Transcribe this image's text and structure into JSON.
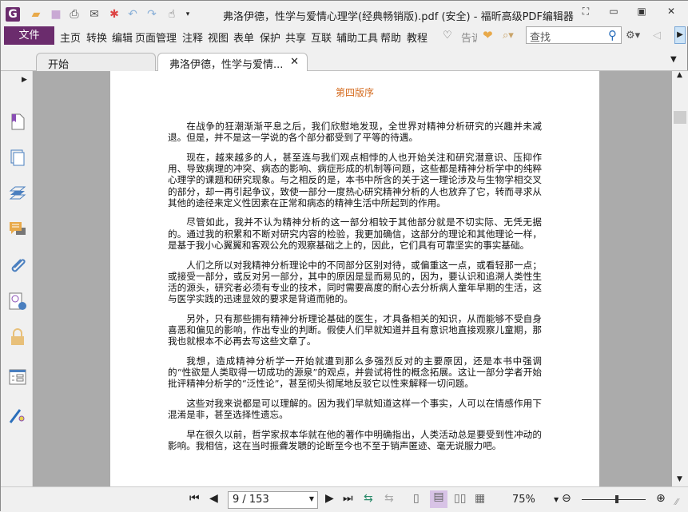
{
  "window": {
    "title": "弗洛伊德，性学与爱情心理学(经典畅销版).pdf (安全) - 福昕高级PDF编辑器"
  },
  "menu": {
    "file": "文件",
    "items": [
      "主页",
      "转换",
      "编辑",
      "页面管理",
      "注释",
      "视图",
      "表单",
      "保护",
      "共享",
      "互联",
      "辅助工具",
      "帮助",
      "教程"
    ],
    "tell": "告诉",
    "search_placeholder": "查找"
  },
  "tabs": [
    {
      "label": "开始"
    },
    {
      "label": "弗洛伊德，性学与爱情...",
      "close": "✕"
    }
  ],
  "page": {
    "title": "第四版序",
    "paragraphs": [
      "在战争的狂潮渐渐平息之后，我们欣慰地发现，全世界对精神分析研究的兴趣并未减退。但是，并不是这一学说的各个部分都受到了平等的待遇。",
      "现在，越来越多的人，甚至连与我们观点相悖的人也开始关注和研究潜意识、压抑作用、导致病理的冲突、病态的影响、病症形成的机制等问题，这些都是精神分析学中的纯粹心理学的课题和研究现象。与之相反的是，本书中所含的关于这一理论涉及与生物学相交叉的部分，却一再引起争议，致使一部分一度热心研究精神分析的人也放弃了它，转而寻求从其他的途径来定义性因素在正常和病态的精神生活中所起到的作用。",
      "尽管如此，我并不认为精神分析的这一部分相较于其他部分就是不切实际、无凭无据的。通过我的积累和不断对研究内容的检验，我更加确信，这部分的理论和其他理论一样，是基于我小心翼翼和客观公允的观察基础之上的，因此，它们具有可靠坚实的事实基础。",
      "人们之所以对我精神分析理论中的不同部分区别对待，或偏重这一点，或看轻那一点；或接受一部分，或反对另一部分，其中的原因是显而易见的，因为，要认识和追溯人类性生活的源头，研究者必须有专业的技术，同时需要高度的耐心去分析病人童年早期的生活，这与医学实践的迅速显效的要求是背道而驰的。",
      "另外，只有那些拥有精神分析理论基础的医生，才具备相关的知识，从而能够不受自身喜恶和偏见的影响，作出专业的判断。假使人们早就知道并且有意识地直接观察儿童期，那我也就根本不必再去写这些文章了。",
      "我想，造成精神分析学一开始就遭到那么多强烈反对的主要原因，还是本书中强调的“性欲是人类取得一切成功的源泉”的观点，并尝试将性的概念拓展。这让一部分学者开始批评精神分析学的“泛性论”，甚至彻头彻尾地反驳它以性来解释一切问题。",
      "这些对我来说都是可以理解的。因为我们早就知道这样一个事实，人可以在情感作用下混淆是非，甚至选择性遗忘。",
      "早在很久以前，哲学家叔本华就在他的著作中明确指出，人类活动总是要受到性冲动的影响。我相信，这在当时振聋发聩的论断至今也不至于销声匿迹、毫无说服力吧。"
    ]
  },
  "status": {
    "page_input": "9 / 153",
    "zoom": "75%",
    "zoom_fraction": 0.55
  },
  "colors": {
    "accent": "#6b2c6d",
    "title_orange": "#d56b1e"
  }
}
